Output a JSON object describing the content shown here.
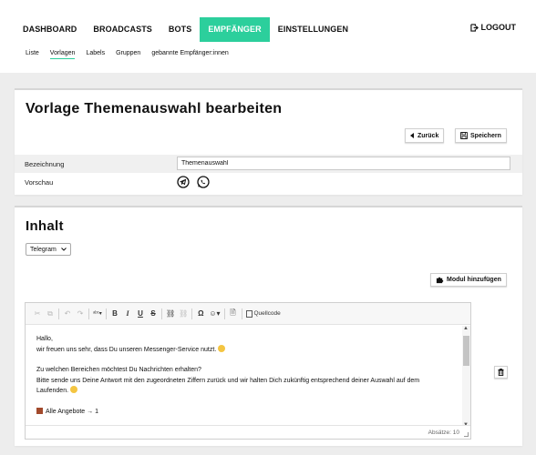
{
  "nav": {
    "main": [
      "DASHBOARD",
      "BROADCASTS",
      "BOTS",
      "EMPFÄNGER",
      "EINSTELLUNGEN"
    ],
    "active_main": "EMPFÄNGER",
    "logout": "LOGOUT",
    "sub": [
      "Liste",
      "Vorlagen",
      "Labels",
      "Gruppen",
      "gebannte Empfänger:innen"
    ],
    "active_sub": "Vorlagen"
  },
  "template_card": {
    "title": "Vorlage Themenauswahl bearbeiten",
    "back_button": "Zurück",
    "save_button": "Speichern",
    "name_label": "Bezeichnung",
    "name_value": "Themenauswahl",
    "preview_label": "Vorschau",
    "preview_icons": [
      "telegram-icon",
      "whatsapp-icon"
    ]
  },
  "content_card": {
    "title": "Inhalt",
    "channel_select": "Telegram",
    "add_module_button": "Modul hinzufügen",
    "toolbar": {
      "source_label": "Quellcode"
    },
    "editor_lines": {
      "greeting": "Hallo,",
      "intro": "wir freuen uns sehr, dass Du unseren Messenger-Service nutzt.",
      "question": "Zu welchen Bereichen möchtest Du Nachrichten erhalten?",
      "instruction_1": "Bitte sende uns Deine Antwort mit den zugeordneten Ziffern zurück und wir halten Dich zukünftig entsprechend deiner Auswahl auf dem",
      "instruction_2": "Laufenden.",
      "option_1": "Alle Angebote → 1"
    },
    "status": "Absätze: 10"
  },
  "colors": {
    "accent": "#2ccf9c",
    "background": "#ededed"
  }
}
